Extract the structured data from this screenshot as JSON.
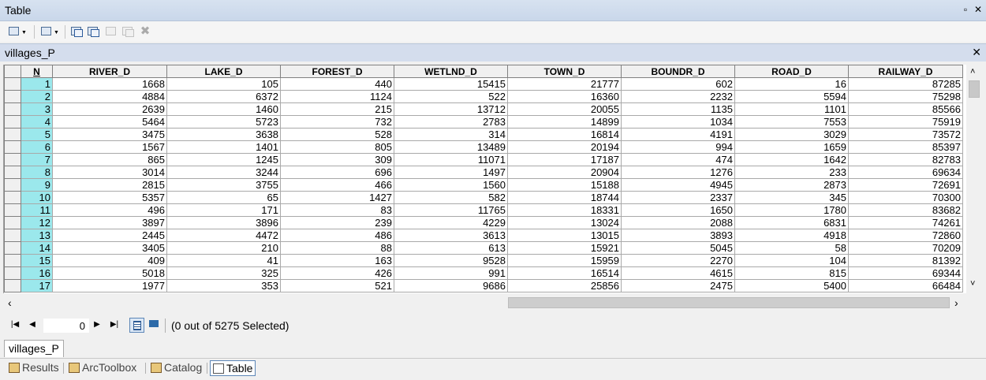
{
  "window": {
    "title": "Table",
    "restore_icon": "restore-icon",
    "close_icon": "close-icon"
  },
  "toolbar": {
    "buttons": [
      {
        "name": "table-options-button",
        "icon": "table-options-icon"
      },
      {
        "name": "related-tables-button",
        "icon": "related-tables-icon"
      },
      {
        "name": "select-by-attributes-button",
        "icon": "select-by-attributes-icon"
      },
      {
        "name": "switch-selection-button",
        "icon": "switch-selection-icon"
      },
      {
        "name": "clear-selection-button",
        "icon": "clear-selection-icon",
        "disabled": true
      },
      {
        "name": "zoom-to-selected-button",
        "icon": "zoom-to-selected-icon",
        "disabled": true
      },
      {
        "name": "delete-selected-button",
        "icon": "delete-icon",
        "disabled": true
      }
    ]
  },
  "table_tab": {
    "label": "villages_P",
    "close": "✕"
  },
  "grid": {
    "columns": [
      "N",
      "RIVER_D",
      "LAKE_D",
      "FOREST_D",
      "WETLND_D",
      "TOWN_D",
      "BOUNDR_D",
      "ROAD_D",
      "RAILWAY_D"
    ],
    "rows": [
      [
        "1",
        "1668",
        "105",
        "440",
        "15415",
        "21777",
        "602",
        "16",
        "87285"
      ],
      [
        "2",
        "4884",
        "6372",
        "1124",
        "522",
        "16360",
        "2232",
        "5594",
        "75298"
      ],
      [
        "3",
        "2639",
        "1460",
        "215",
        "13712",
        "20055",
        "1135",
        "1101",
        "85566"
      ],
      [
        "4",
        "5464",
        "5723",
        "732",
        "2783",
        "14899",
        "1034",
        "7553",
        "75919"
      ],
      [
        "5",
        "3475",
        "3638",
        "528",
        "314",
        "16814",
        "4191",
        "3029",
        "73572"
      ],
      [
        "6",
        "1567",
        "1401",
        "805",
        "13489",
        "20194",
        "994",
        "1659",
        "85397"
      ],
      [
        "7",
        "865",
        "1245",
        "309",
        "11071",
        "17187",
        "474",
        "1642",
        "82783"
      ],
      [
        "8",
        "3014",
        "3244",
        "696",
        "1497",
        "20904",
        "1276",
        "233",
        "69634"
      ],
      [
        "9",
        "2815",
        "3755",
        "466",
        "1560",
        "15188",
        "4945",
        "2873",
        "72691"
      ],
      [
        "10",
        "5357",
        "65",
        "1427",
        "582",
        "18744",
        "2337",
        "345",
        "70300"
      ],
      [
        "11",
        "496",
        "171",
        "83",
        "11765",
        "18331",
        "1650",
        "1780",
        "83682"
      ],
      [
        "12",
        "3897",
        "3896",
        "239",
        "4229",
        "13024",
        "2088",
        "6831",
        "74261"
      ],
      [
        "13",
        "2445",
        "4472",
        "486",
        "3613",
        "13015",
        "3893",
        "4918",
        "72860"
      ],
      [
        "14",
        "3405",
        "210",
        "88",
        "613",
        "15921",
        "5045",
        "58",
        "70209"
      ],
      [
        "15",
        "409",
        "41",
        "163",
        "9528",
        "15959",
        "2270",
        "104",
        "81392"
      ],
      [
        "16",
        "5018",
        "325",
        "426",
        "991",
        "16514",
        "4615",
        "815",
        "69344"
      ],
      [
        "17",
        "1977",
        "353",
        "521",
        "9686",
        "25856",
        "2475",
        "5400",
        "66484"
      ]
    ]
  },
  "navigation": {
    "first": "⏮",
    "prev": "◀",
    "current_record": "0",
    "next": "▶",
    "last": "⏭",
    "selection_text": "(0 out of 5275 Selected)"
  },
  "bottom_table_tab": {
    "label": "villages_P"
  },
  "dock_tabs": [
    {
      "label": "Results",
      "icon": "results-icon",
      "active": false
    },
    {
      "label": "ArcToolbox",
      "icon": "toolbox-icon",
      "active": false
    },
    {
      "label": "Catalog",
      "icon": "catalog-icon",
      "active": false
    },
    {
      "label": "Table",
      "icon": "table-icon",
      "active": true
    }
  ]
}
